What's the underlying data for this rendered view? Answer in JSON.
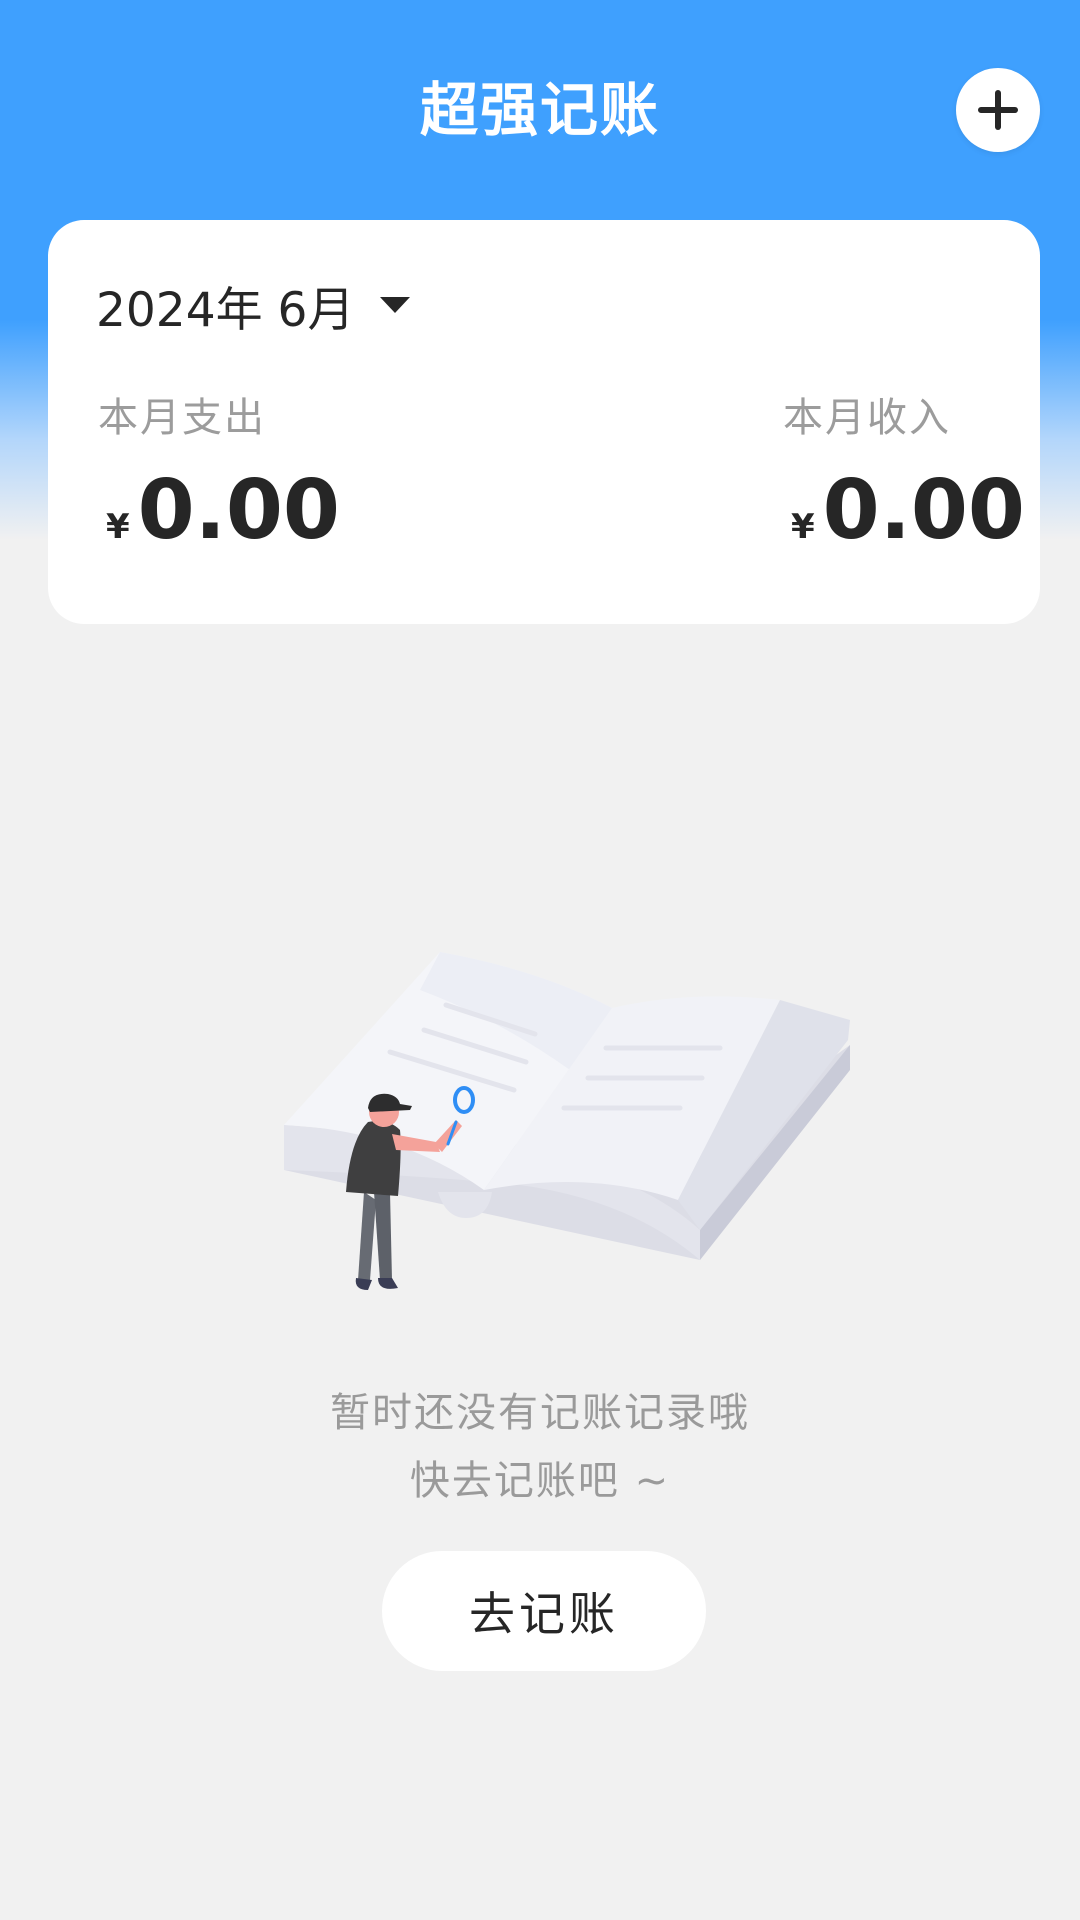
{
  "header": {
    "title": "超强记账",
    "add_icon": "plus-icon"
  },
  "summary": {
    "month_label": "2024年 6月",
    "dropdown_icon": "caret-down-icon",
    "expense": {
      "label": "本月支出",
      "currency": "¥",
      "amount": "0.00"
    },
    "income": {
      "label": "本月收入",
      "currency": "¥",
      "amount": "0.00"
    }
  },
  "empty_state": {
    "illustration": "person-with-magnifier-book-illustration",
    "line1": "暂时还没有记账记录哦",
    "line2": "快去记账吧 ~",
    "button_label": "去记账"
  },
  "colors": {
    "primary_blue": "#3fa0fe",
    "background": "#f1f1f1",
    "card": "#ffffff",
    "text_dark": "#262626",
    "text_gray": "#9c9c9c",
    "magnifier_blue": "#2f8ef5"
  }
}
